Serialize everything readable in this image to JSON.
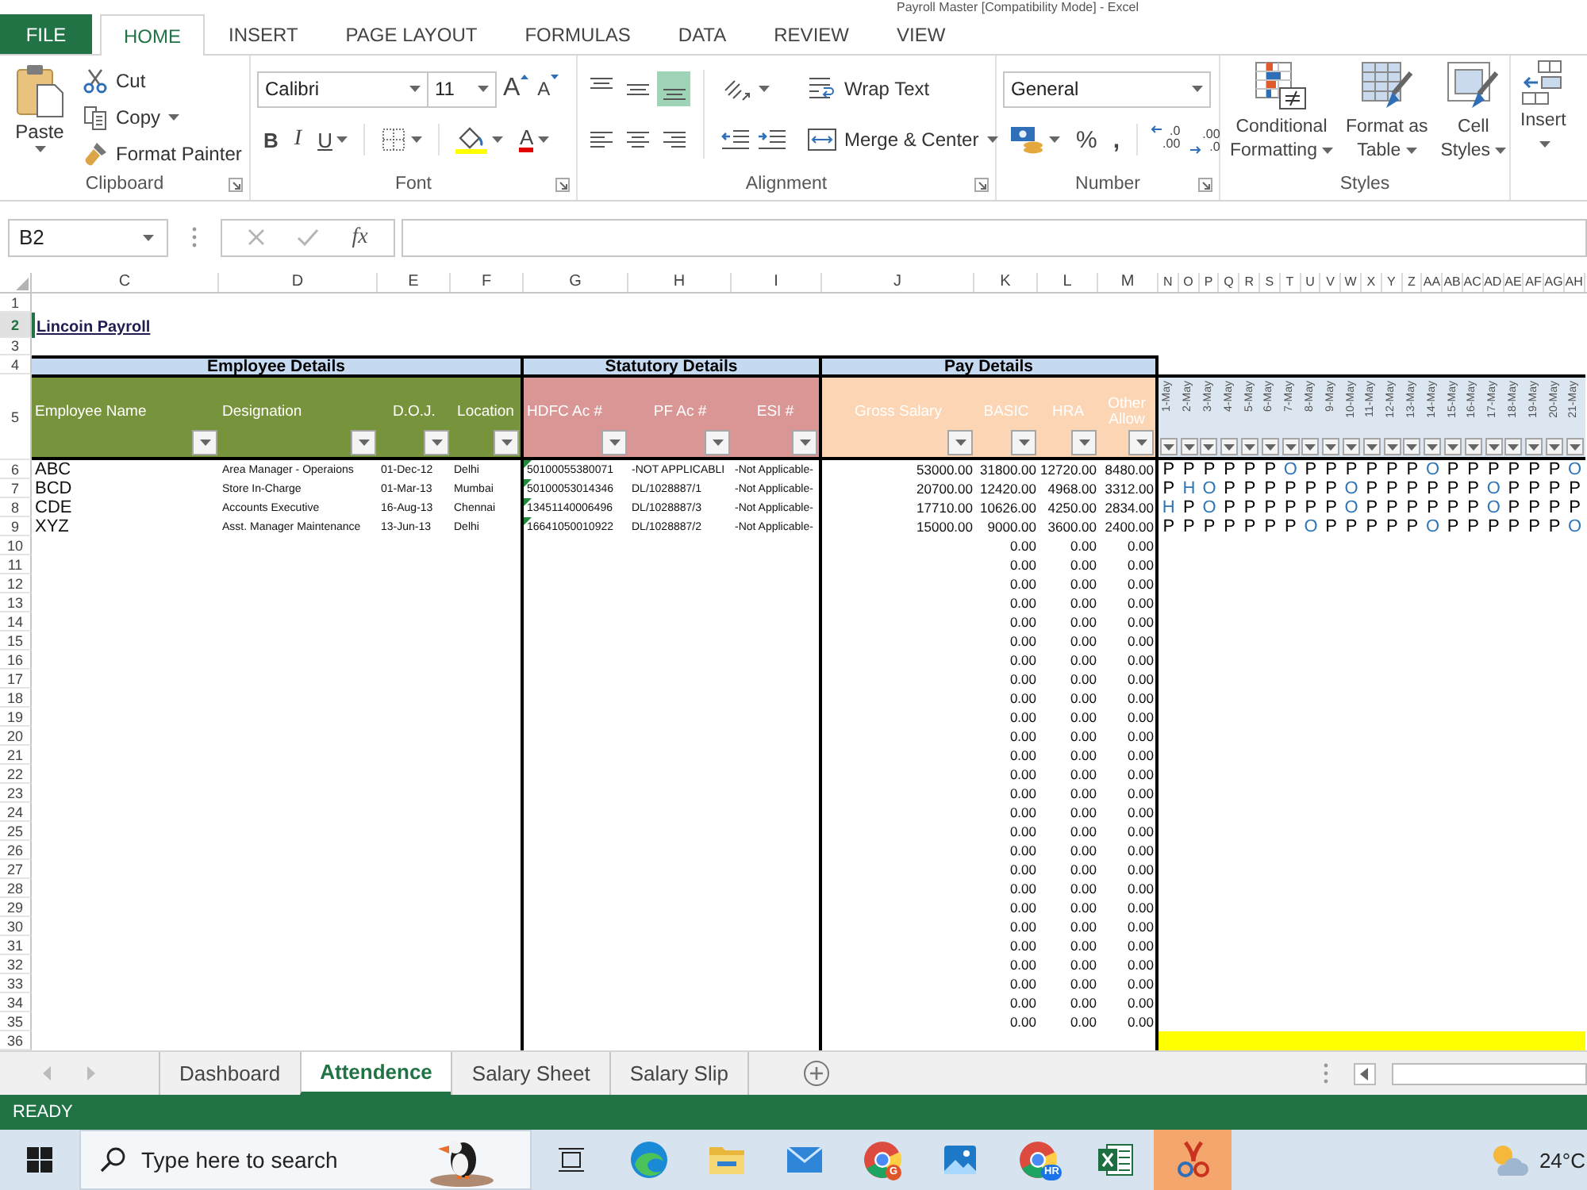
{
  "window": {
    "title": "Payroll Master [Compatibility Mode] - Excel"
  },
  "ribbon_tabs": [
    {
      "label": "FILE",
      "kind": "file",
      "selected": false
    },
    {
      "label": "HOME",
      "kind": "tab",
      "selected": true
    },
    {
      "label": "INSERT",
      "kind": "tab",
      "selected": false
    },
    {
      "label": "PAGE LAYOUT",
      "kind": "tab",
      "selected": false
    },
    {
      "label": "FORMULAS",
      "kind": "tab",
      "selected": false
    },
    {
      "label": "DATA",
      "kind": "tab",
      "selected": false
    },
    {
      "label": "REVIEW",
      "kind": "tab",
      "selected": false
    },
    {
      "label": "VIEW",
      "kind": "tab",
      "selected": false
    }
  ],
  "clipboard": {
    "label": "Clipboard",
    "paste": "Paste",
    "actions": [
      {
        "kind": "cut",
        "label": "Cut",
        "dropdown": false
      },
      {
        "kind": "copy",
        "label": "Copy",
        "dropdown": true
      },
      {
        "kind": "painter",
        "label": "Format Painter",
        "dropdown": false
      }
    ]
  },
  "font": {
    "label": "Font",
    "name": "Calibri",
    "size": "11",
    "grow": "A",
    "shrink": "A",
    "bold": "B",
    "italic": "I",
    "underline": "U",
    "font_color": "A"
  },
  "alignment": {
    "label": "Alignment",
    "vertical": [
      {
        "kind": "top",
        "selected": false
      },
      {
        "kind": "middle",
        "selected": false
      },
      {
        "kind": "bottom",
        "selected": true
      }
    ],
    "horizontal": [
      {
        "kind": "left",
        "selected": false
      },
      {
        "kind": "center",
        "selected": false
      },
      {
        "kind": "right",
        "selected": false
      }
    ],
    "wrap_text": "Wrap Text",
    "merge": "Merge & Center"
  },
  "number": {
    "label": "Number",
    "format": "General",
    "percent": "%",
    "comma": ",",
    "decimals": [
      {
        "kind": "increase",
        "lines": [
          ".0",
          ".00"
        ]
      },
      {
        "kind": "decrease",
        "lines": [
          ".00",
          ".0"
        ]
      }
    ]
  },
  "styles": {
    "label": "Styles",
    "buttons": [
      {
        "kind": "conditional",
        "lines": [
          "Conditional",
          "Formatting"
        ]
      },
      {
        "kind": "table",
        "lines": [
          "Format as",
          "Table"
        ]
      },
      {
        "kind": "cell",
        "lines": [
          "Cell",
          "Styles"
        ]
      }
    ]
  },
  "cells": {
    "insert": "Insert"
  },
  "formula_bar": {
    "name_box": "B2",
    "fx": "fx"
  },
  "sheet": {
    "columns": [
      "C",
      "D",
      "E",
      "F",
      "G",
      "H",
      "I",
      "J",
      "K",
      "L",
      "M",
      "N",
      "O",
      "P",
      "Q",
      "R",
      "S",
      "T",
      "U",
      "V",
      "W",
      "X",
      "Y",
      "Z",
      "AA",
      "AB",
      "AC",
      "AD",
      "AE",
      "AF",
      "AG",
      "AH"
    ],
    "rows": [
      {
        "label": "1",
        "selected": false
      },
      {
        "label": "2",
        "selected": true
      },
      {
        "label": "3",
        "selected": false
      },
      {
        "label": "4",
        "selected": false
      },
      {
        "label": "5",
        "selected": false
      },
      {
        "label": "6",
        "selected": false
      },
      {
        "label": "7",
        "selected": false
      },
      {
        "label": "8",
        "selected": false
      },
      {
        "label": "9",
        "selected": false
      },
      {
        "label": "10",
        "selected": false
      },
      {
        "label": "11",
        "selected": false
      },
      {
        "label": "12",
        "selected": false
      },
      {
        "label": "13",
        "selected": false
      },
      {
        "label": "14",
        "selected": false
      },
      {
        "label": "15",
        "selected": false
      },
      {
        "label": "16",
        "selected": false
      },
      {
        "label": "17",
        "selected": false
      },
      {
        "label": "18",
        "selected": false
      },
      {
        "label": "19",
        "selected": false
      },
      {
        "label": "20",
        "selected": false
      },
      {
        "label": "21",
        "selected": false
      },
      {
        "label": "22",
        "selected": false
      },
      {
        "label": "23",
        "selected": false
      },
      {
        "label": "24",
        "selected": false
      },
      {
        "label": "25",
        "selected": false
      },
      {
        "label": "26",
        "selected": false
      },
      {
        "label": "27",
        "selected": false
      },
      {
        "label": "28",
        "selected": false
      },
      {
        "label": "29",
        "selected": false
      },
      {
        "label": "30",
        "selected": false
      },
      {
        "label": "31",
        "selected": false
      },
      {
        "label": "32",
        "selected": false
      },
      {
        "label": "33",
        "selected": false
      },
      {
        "label": "34",
        "selected": false
      },
      {
        "label": "35",
        "selected": false
      },
      {
        "label": "36",
        "selected": false
      }
    ],
    "title": "Lincoin Payroll",
    "sections": [
      "Employee Details",
      "Statutory Details",
      "Pay Details"
    ],
    "headers": [
      "Employee Name",
      "Designation",
      "D.O.J.",
      "Location",
      "HDFC Ac #",
      "PF Ac #",
      "ESI #",
      "Gross Salary",
      "BASIC",
      "HRA",
      "Other Allow"
    ],
    "dates": [
      "1-May",
      "2-May",
      "3-May",
      "4-May",
      "5-May",
      "6-May",
      "7-May",
      "8-May",
      "9-May",
      "10-May",
      "11-May",
      "12-May",
      "13-May",
      "14-May",
      "15-May",
      "16-May",
      "17-May",
      "18-May",
      "19-May",
      "20-May",
      "21-May"
    ],
    "employees": [
      {
        "cells": [
          "ABC",
          "Area Manager - Operaions",
          "01-Dec-12",
          "Delhi",
          "50100055380071",
          "-NOT APPLICABLI",
          "-Not Applicable-",
          "53000.00",
          "31800.00",
          "12720.00",
          "8480.00"
        ],
        "flagged": true,
        "attendance": [
          {
            "mark": "P",
            "color": "#000000"
          },
          {
            "mark": "P",
            "color": "#000000"
          },
          {
            "mark": "P",
            "color": "#000000"
          },
          {
            "mark": "P",
            "color": "#000000"
          },
          {
            "mark": "P",
            "color": "#000000"
          },
          {
            "mark": "P",
            "color": "#000000"
          },
          {
            "mark": "O",
            "color": "#2f75b5"
          },
          {
            "mark": "P",
            "color": "#000000"
          },
          {
            "mark": "P",
            "color": "#000000"
          },
          {
            "mark": "P",
            "color": "#000000"
          },
          {
            "mark": "P",
            "color": "#000000"
          },
          {
            "mark": "P",
            "color": "#000000"
          },
          {
            "mark": "P",
            "color": "#000000"
          },
          {
            "mark": "O",
            "color": "#2f75b5"
          },
          {
            "mark": "P",
            "color": "#000000"
          },
          {
            "mark": "P",
            "color": "#000000"
          },
          {
            "mark": "P",
            "color": "#000000"
          },
          {
            "mark": "P",
            "color": "#000000"
          },
          {
            "mark": "P",
            "color": "#000000"
          },
          {
            "mark": "P",
            "color": "#000000"
          },
          {
            "mark": "O",
            "color": "#2f75b5"
          }
        ]
      },
      {
        "cells": [
          "BCD",
          "Store In-Charge",
          "01-Mar-13",
          "Mumbai",
          "50100053014346",
          "DL/1028887/1",
          "-Not Applicable-",
          "20700.00",
          "12420.00",
          "4968.00",
          "3312.00"
        ],
        "flagged": true,
        "attendance": [
          {
            "mark": "P",
            "color": "#000000"
          },
          {
            "mark": "H",
            "color": "#2f75b5"
          },
          {
            "mark": "O",
            "color": "#2f75b5"
          },
          {
            "mark": "P",
            "color": "#000000"
          },
          {
            "mark": "P",
            "color": "#000000"
          },
          {
            "mark": "P",
            "color": "#000000"
          },
          {
            "mark": "P",
            "color": "#000000"
          },
          {
            "mark": "P",
            "color": "#000000"
          },
          {
            "mark": "P",
            "color": "#000000"
          },
          {
            "mark": "O",
            "color": "#2f75b5"
          },
          {
            "mark": "P",
            "color": "#000000"
          },
          {
            "mark": "P",
            "color": "#000000"
          },
          {
            "mark": "P",
            "color": "#000000"
          },
          {
            "mark": "P",
            "color": "#000000"
          },
          {
            "mark": "P",
            "color": "#000000"
          },
          {
            "mark": "P",
            "color": "#000000"
          },
          {
            "mark": "O",
            "color": "#2f75b5"
          },
          {
            "mark": "P",
            "color": "#000000"
          },
          {
            "mark": "P",
            "color": "#000000"
          },
          {
            "mark": "P",
            "color": "#000000"
          },
          {
            "mark": "P",
            "color": "#000000"
          }
        ]
      },
      {
        "cells": [
          "CDE",
          "Accounts Executive",
          "16-Aug-13",
          "Chennai",
          "13451140006496",
          "DL/1028887/3",
          "-Not Applicable-",
          "17710.00",
          "10626.00",
          "4250.00",
          "2834.00"
        ],
        "flagged": true,
        "attendance": [
          {
            "mark": "H",
            "color": "#2f75b5"
          },
          {
            "mark": "P",
            "color": "#000000"
          },
          {
            "mark": "O",
            "color": "#2f75b5"
          },
          {
            "mark": "P",
            "color": "#000000"
          },
          {
            "mark": "P",
            "color": "#000000"
          },
          {
            "mark": "P",
            "color": "#000000"
          },
          {
            "mark": "P",
            "color": "#000000"
          },
          {
            "mark": "P",
            "color": "#000000"
          },
          {
            "mark": "P",
            "color": "#000000"
          },
          {
            "mark": "O",
            "color": "#2f75b5"
          },
          {
            "mark": "P",
            "color": "#000000"
          },
          {
            "mark": "P",
            "color": "#000000"
          },
          {
            "mark": "P",
            "color": "#000000"
          },
          {
            "mark": "P",
            "color": "#000000"
          },
          {
            "mark": "P",
            "color": "#000000"
          },
          {
            "mark": "P",
            "color": "#000000"
          },
          {
            "mark": "O",
            "color": "#2f75b5"
          },
          {
            "mark": "P",
            "color": "#000000"
          },
          {
            "mark": "P",
            "color": "#000000"
          },
          {
            "mark": "P",
            "color": "#000000"
          },
          {
            "mark": "P",
            "color": "#000000"
          }
        ]
      },
      {
        "cells": [
          "XYZ",
          "Asst. Manager Maintenance",
          "13-Jun-13",
          "Delhi",
          "16641050010922",
          "DL/1028887/2",
          "-Not Applicable-",
          "15000.00",
          "9000.00",
          "3600.00",
          "2400.00"
        ],
        "flagged": true,
        "attendance": [
          {
            "mark": "P",
            "color": "#000000"
          },
          {
            "mark": "P",
            "color": "#000000"
          },
          {
            "mark": "P",
            "color": "#000000"
          },
          {
            "mark": "P",
            "color": "#000000"
          },
          {
            "mark": "P",
            "color": "#000000"
          },
          {
            "mark": "P",
            "color": "#000000"
          },
          {
            "mark": "P",
            "color": "#000000"
          },
          {
            "mark": "O",
            "color": "#2f75b5"
          },
          {
            "mark": "P",
            "color": "#000000"
          },
          {
            "mark": "P",
            "color": "#000000"
          },
          {
            "mark": "P",
            "color": "#000000"
          },
          {
            "mark": "P",
            "color": "#000000"
          },
          {
            "mark": "P",
            "color": "#000000"
          },
          {
            "mark": "O",
            "color": "#2f75b5"
          },
          {
            "mark": "P",
            "color": "#000000"
          },
          {
            "mark": "P",
            "color": "#000000"
          },
          {
            "mark": "P",
            "color": "#000000"
          },
          {
            "mark": "P",
            "color": "#000000"
          },
          {
            "mark": "P",
            "color": "#000000"
          },
          {
            "mark": "P",
            "color": "#000000"
          },
          {
            "mark": "O",
            "color": "#2f75b5"
          }
        ]
      }
    ],
    "filler_rows": [
      {
        "cells": [
          "0.00",
          "0.00",
          "0.00"
        ],
        "highlighted": false
      },
      {
        "cells": [
          "0.00",
          "0.00",
          "0.00"
        ],
        "highlighted": false
      },
      {
        "cells": [
          "0.00",
          "0.00",
          "0.00"
        ],
        "highlighted": false
      },
      {
        "cells": [
          "0.00",
          "0.00",
          "0.00"
        ],
        "highlighted": false
      },
      {
        "cells": [
          "0.00",
          "0.00",
          "0.00"
        ],
        "highlighted": false
      },
      {
        "cells": [
          "0.00",
          "0.00",
          "0.00"
        ],
        "highlighted": false
      },
      {
        "cells": [
          "0.00",
          "0.00",
          "0.00"
        ],
        "highlighted": false
      },
      {
        "cells": [
          "0.00",
          "0.00",
          "0.00"
        ],
        "highlighted": false
      },
      {
        "cells": [
          "0.00",
          "0.00",
          "0.00"
        ],
        "highlighted": false
      },
      {
        "cells": [
          "0.00",
          "0.00",
          "0.00"
        ],
        "highlighted": false
      },
      {
        "cells": [
          "0.00",
          "0.00",
          "0.00"
        ],
        "highlighted": false
      },
      {
        "cells": [
          "0.00",
          "0.00",
          "0.00"
        ],
        "highlighted": false
      },
      {
        "cells": [
          "0.00",
          "0.00",
          "0.00"
        ],
        "highlighted": false
      },
      {
        "cells": [
          "0.00",
          "0.00",
          "0.00"
        ],
        "highlighted": false
      },
      {
        "cells": [
          "0.00",
          "0.00",
          "0.00"
        ],
        "highlighted": false
      },
      {
        "cells": [
          "0.00",
          "0.00",
          "0.00"
        ],
        "highlighted": false
      },
      {
        "cells": [
          "0.00",
          "0.00",
          "0.00"
        ],
        "highlighted": false
      },
      {
        "cells": [
          "0.00",
          "0.00",
          "0.00"
        ],
        "highlighted": false
      },
      {
        "cells": [
          "0.00",
          "0.00",
          "0.00"
        ],
        "highlighted": false
      },
      {
        "cells": [
          "0.00",
          "0.00",
          "0.00"
        ],
        "highlighted": false
      },
      {
        "cells": [
          "0.00",
          "0.00",
          "0.00"
        ],
        "highlighted": false
      },
      {
        "cells": [
          "0.00",
          "0.00",
          "0.00"
        ],
        "highlighted": false
      },
      {
        "cells": [
          "0.00",
          "0.00",
          "0.00"
        ],
        "highlighted": false
      },
      {
        "cells": [
          "0.00",
          "0.00",
          "0.00"
        ],
        "highlighted": false
      },
      {
        "cells": [
          "0.00",
          "0.00",
          "0.00"
        ],
        "highlighted": false
      },
      {
        "cells": [
          "0.00",
          "0.00",
          "0.00"
        ],
        "highlighted": false
      },
      {
        "highlighted": true
      }
    ]
  },
  "sheet_tabs": [
    {
      "label": "Dashboard",
      "selected": false
    },
    {
      "label": "Attendence",
      "selected": true
    },
    {
      "label": "Salary Sheet",
      "selected": false
    },
    {
      "label": "Salary Slip",
      "selected": false
    }
  ],
  "status_bar": {
    "text": "READY"
  },
  "taskbar": {
    "search": {
      "placeholder": "Type here to search"
    },
    "apps": [
      {
        "kind": "task_view",
        "selected": false
      },
      {
        "kind": "browser",
        "selected": false
      },
      {
        "kind": "folder",
        "selected": false
      },
      {
        "kind": "mail",
        "selected": false
      },
      {
        "kind": "ring",
        "badge": {
          "text": "G",
          "color": "#e0542a"
        },
        "selected": false
      },
      {
        "kind": "photos",
        "selected": false
      },
      {
        "kind": "ring",
        "badge": {
          "text": "HR",
          "color": "#1a73e8"
        },
        "selected": false
      },
      {
        "kind": "sheet",
        "selected": false
      },
      {
        "kind": "snip",
        "selected": true
      }
    ],
    "weather": {
      "temperature": "24°C"
    }
  }
}
